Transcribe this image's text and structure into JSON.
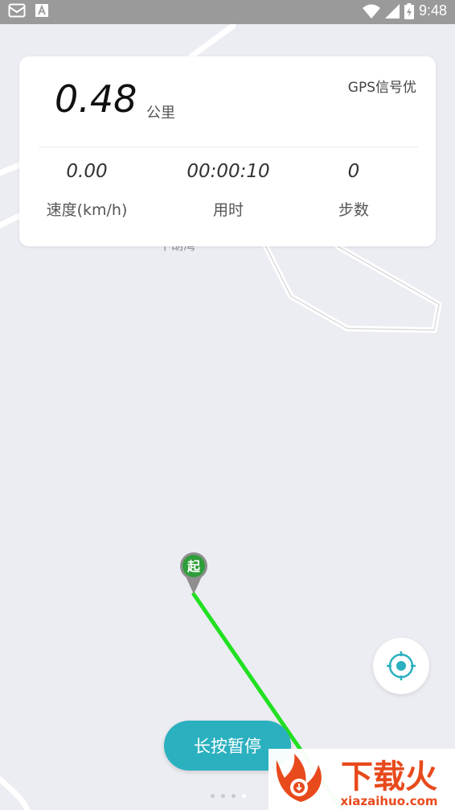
{
  "status_bar": {
    "time": "9:48",
    "icons": [
      "notification-icon",
      "text-icon",
      "wifi-icon",
      "signal-icon",
      "battery-charging-icon"
    ]
  },
  "map": {
    "place_label": "下胡湾",
    "background_color": "#ecedf2",
    "road_color": "#ffffff",
    "track_color": "#22e022"
  },
  "stats": {
    "distance_value": "0.48",
    "distance_unit": "公里",
    "gps_status": "GPS信号优",
    "speed_value": "0.00",
    "speed_label": "速度(km/h)",
    "time_value": "00:00:10",
    "time_label": "用时",
    "steps_value": "0",
    "steps_label": "步数"
  },
  "start_marker": {
    "label": "起",
    "color": "#2e9e3a"
  },
  "controls": {
    "pause_label": "长按暂停",
    "accent_color": "#2bb0bf",
    "locate_icon": "crosshair-icon"
  },
  "pagination": {
    "count": 4,
    "active_index": 3
  },
  "watermark": {
    "brand": "下载火",
    "url": "xiazaihuo.com",
    "color": "#e84a1c"
  }
}
